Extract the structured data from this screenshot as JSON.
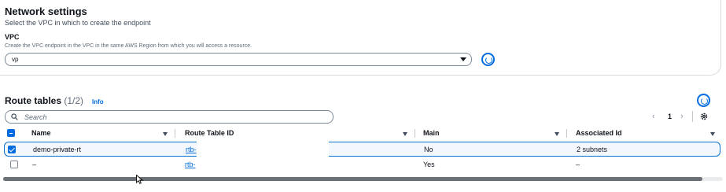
{
  "network": {
    "title": "Network settings",
    "description": "Select the VPC in which to create the endpoint",
    "vpc_label": "VPC",
    "vpc_description": "Create the VPC endpoint in the VPC in the same AWS Region from which you will access a resource.",
    "vpc_value": "vp"
  },
  "route_tables": {
    "title": "Route tables",
    "count": "(1/2)",
    "info_link": "Info",
    "search_placeholder": "Search",
    "current_page": "1",
    "columns": [
      "Name",
      "Route Table ID",
      "Main",
      "Associated Id"
    ],
    "rows": [
      {
        "selected": true,
        "name": "demo-private-rt",
        "route_table_id": "rtb-",
        "main": "No",
        "associated_id": "2 subnets"
      },
      {
        "selected": false,
        "name": "–",
        "route_table_id": "rtb-",
        "main": "Yes",
        "associated_id": "–"
      }
    ]
  },
  "icons": {
    "refresh": "refresh-icon",
    "search": "search-icon",
    "settings": "gear-icon",
    "pager_prev": "chevron-left-icon",
    "pager_next": "chevron-right-icon"
  },
  "colors": {
    "accent": "#006ce0",
    "selected_row_bg": "#f2f8fd",
    "selected_row_border": "#0972d3",
    "text": "#0f141a"
  }
}
